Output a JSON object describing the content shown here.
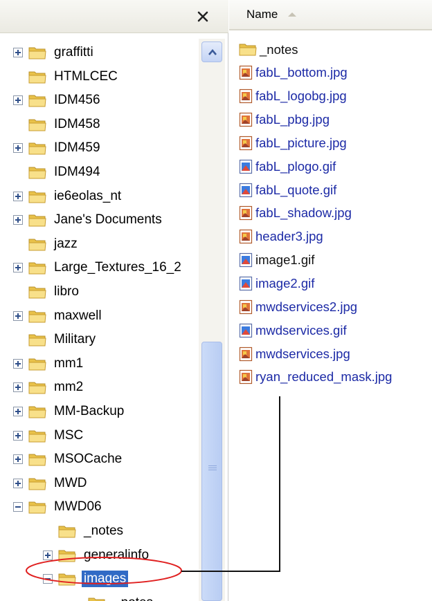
{
  "tree": {
    "items": [
      {
        "label": "graffitti",
        "expander": "plus",
        "indent": 0
      },
      {
        "label": "HTMLCEC",
        "expander": "none",
        "indent": 0
      },
      {
        "label": "IDM456",
        "expander": "plus",
        "indent": 0
      },
      {
        "label": "IDM458",
        "expander": "none",
        "indent": 0
      },
      {
        "label": "IDM459",
        "expander": "plus",
        "indent": 0
      },
      {
        "label": "IDM494",
        "expander": "none",
        "indent": 0
      },
      {
        "label": "ie6eolas_nt",
        "expander": "plus",
        "indent": 0
      },
      {
        "label": "Jane's Documents",
        "expander": "plus",
        "indent": 0
      },
      {
        "label": "jazz",
        "expander": "none",
        "indent": 0
      },
      {
        "label": "Large_Textures_16_2",
        "expander": "plus",
        "indent": 0
      },
      {
        "label": "libro",
        "expander": "none",
        "indent": 0
      },
      {
        "label": "maxwell",
        "expander": "plus",
        "indent": 0
      },
      {
        "label": "Military",
        "expander": "none",
        "indent": 0
      },
      {
        "label": "mm1",
        "expander": "plus",
        "indent": 0
      },
      {
        "label": "mm2",
        "expander": "plus",
        "indent": 0
      },
      {
        "label": "MM-Backup",
        "expander": "plus",
        "indent": 0
      },
      {
        "label": "MSC",
        "expander": "plus",
        "indent": 0
      },
      {
        "label": "MSOCache",
        "expander": "plus",
        "indent": 0
      },
      {
        "label": "MWD",
        "expander": "plus",
        "indent": 0
      },
      {
        "label": "MWD06",
        "expander": "minus",
        "indent": 0
      },
      {
        "label": "_notes",
        "expander": "none",
        "indent": 1
      },
      {
        "label": "generalinfo",
        "expander": "plus",
        "indent": 1
      },
      {
        "label": "images",
        "expander": "minus",
        "indent": 1,
        "selected": true
      },
      {
        "label": "_notes",
        "expander": "none",
        "indent": 2
      }
    ],
    "scroll_position": 0.75
  },
  "list": {
    "column_header": "Name",
    "sort": "ascending",
    "files": [
      {
        "name": "_notes",
        "type": "folder",
        "color": "black"
      },
      {
        "name": "fabL_bottom.jpg",
        "type": "jpg",
        "color": "blue"
      },
      {
        "name": "fabL_logobg.jpg",
        "type": "jpg",
        "color": "blue"
      },
      {
        "name": "fabL_pbg.jpg",
        "type": "jpg",
        "color": "blue"
      },
      {
        "name": "fabL_picture.jpg",
        "type": "jpg",
        "color": "blue"
      },
      {
        "name": "fabL_plogo.gif",
        "type": "gif",
        "color": "blue"
      },
      {
        "name": "fabL_quote.gif",
        "type": "gif",
        "color": "blue"
      },
      {
        "name": "fabL_shadow.jpg",
        "type": "jpg",
        "color": "blue"
      },
      {
        "name": "header3.jpg",
        "type": "jpg",
        "color": "blue"
      },
      {
        "name": "image1.gif",
        "type": "gif",
        "color": "black"
      },
      {
        "name": "image2.gif",
        "type": "gif",
        "color": "blue"
      },
      {
        "name": "mwdservices2.jpg",
        "type": "jpg",
        "color": "blue"
      },
      {
        "name": "mwdservices.gif",
        "type": "gif",
        "color": "blue"
      },
      {
        "name": "mwdservices.jpg",
        "type": "jpg",
        "color": "blue"
      },
      {
        "name": "ryan_reduced_mask.jpg",
        "type": "jpg",
        "color": "blue"
      }
    ]
  },
  "colors": {
    "selection": "#316ac5",
    "link_blue": "#1c2aa6",
    "annotation_red": "#e02020"
  },
  "icons": {
    "close": "close-icon",
    "folder": "folder-icon",
    "jpg": "jpg-file-icon",
    "gif": "gif-file-icon",
    "sort": "sort-ascending-icon"
  }
}
